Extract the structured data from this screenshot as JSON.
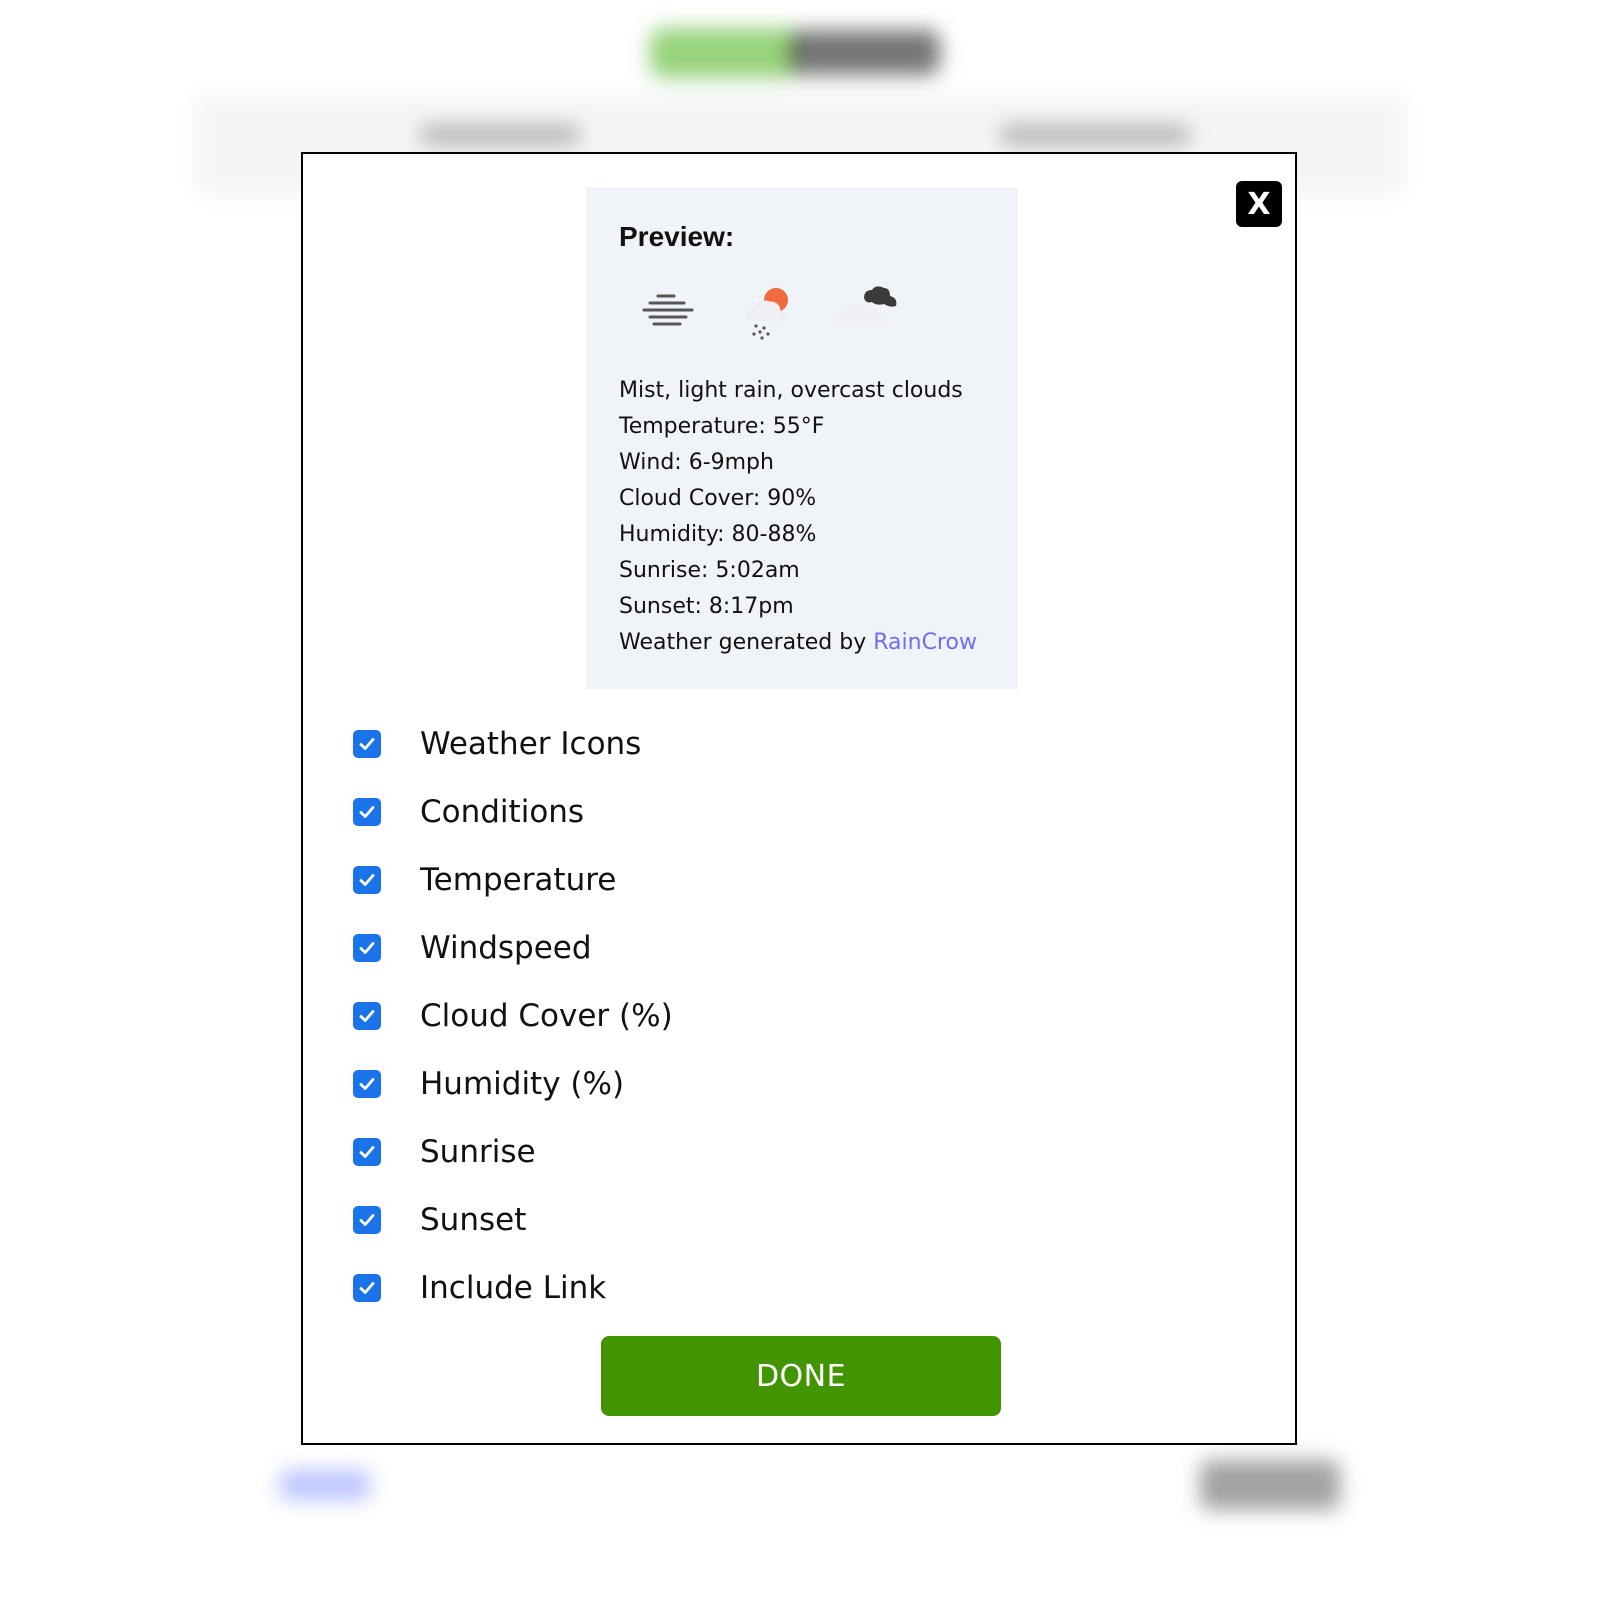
{
  "modal": {
    "close_label": "X",
    "preview": {
      "title": "Preview:",
      "icons": [
        "mist-icon",
        "light-rain-day-icon",
        "overcast-clouds-icon"
      ],
      "lines": [
        "Mist, light rain, overcast clouds",
        "Temperature: 55°F",
        "Wind: 6-9mph",
        "Cloud Cover: 90%",
        "Humidity: 80-88%",
        "Sunrise: 5:02am",
        "Sunset: 8:17pm"
      ],
      "attribution_prefix": "Weather generated by ",
      "attribution_link": "RainCrow",
      "link_color": "#6f6cf5"
    },
    "options": [
      {
        "label": "Weather Icons",
        "checked": true
      },
      {
        "label": "Conditions",
        "checked": true
      },
      {
        "label": "Temperature",
        "checked": true
      },
      {
        "label": "Windspeed",
        "checked": true
      },
      {
        "label": "Cloud Cover (%)",
        "checked": true
      },
      {
        "label": "Humidity (%)",
        "checked": true
      },
      {
        "label": "Sunrise",
        "checked": true
      },
      {
        "label": "Sunset",
        "checked": true
      },
      {
        "label": "Include Link",
        "checked": true
      }
    ],
    "done_label": "DONE",
    "colors": {
      "checkbox": "#1a73e8",
      "done_button": "#429400",
      "preview_bg": "#f0f4f8"
    }
  }
}
